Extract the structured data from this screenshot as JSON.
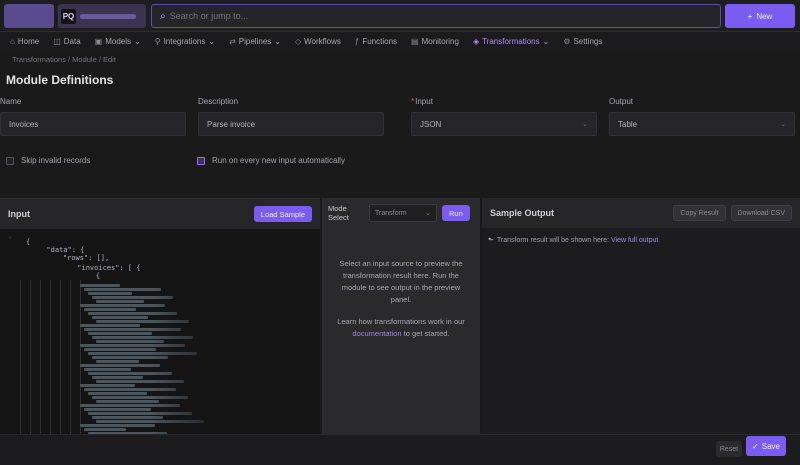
{
  "topbar": {
    "org_badge": "PQ",
    "search_placeholder": "Search or jump to...",
    "search_icon": "search-icon",
    "action_label": "New"
  },
  "nav": {
    "items": [
      {
        "label": "Home",
        "icon": "home-icon",
        "active": false
      },
      {
        "label": "Data",
        "icon": "database-icon",
        "active": false
      },
      {
        "label": "Models",
        "icon": "cube-icon",
        "active": false
      },
      {
        "label": "Integrations",
        "icon": "plug-icon",
        "active": false
      },
      {
        "label": "Pipelines",
        "icon": "flow-icon",
        "active": false
      },
      {
        "label": "Workflows",
        "icon": "workflow-icon",
        "active": false
      },
      {
        "label": "Functions",
        "icon": "function-icon",
        "active": false
      },
      {
        "label": "Monitoring",
        "icon": "chart-icon",
        "active": false
      },
      {
        "label": "Transformations",
        "icon": "transform-icon",
        "active": true
      },
      {
        "label": "Settings",
        "icon": "gear-icon",
        "active": false
      }
    ]
  },
  "breadcrumb": "Transformations / Module / Edit",
  "page_title": "Module Definitions",
  "form": {
    "fields": [
      {
        "label": "Name",
        "value": "Invoices",
        "required": false,
        "select": false
      },
      {
        "label": "Description",
        "value": "Parse invoice",
        "required": false,
        "select": false
      },
      {
        "label": "Input",
        "value": "JSON",
        "required": true,
        "select": true
      },
      {
        "label": "Output",
        "value": "Table",
        "required": false,
        "select": true
      }
    ],
    "checks": [
      {
        "label": "Skip invalid records",
        "checked": false
      },
      {
        "label": "Run on every new input automatically",
        "checked": true
      }
    ]
  },
  "panels": {
    "left": {
      "title": "Input",
      "button": "Load Sample",
      "code_lines": [
        "{",
        "  \"data\": {",
        "    \"rows\": [],",
        "      \"invoices\": [ {",
        "        {"
      ]
    },
    "mid": {
      "label": "Mode Select",
      "select_value": "Transform",
      "button": "Run",
      "body_1": "Select an input source to preview the transformation result here. Run the module to see output in the preview panel.",
      "body_2_prefix": "Learn how transformations work in our",
      "body_2_link": "documentation",
      "body_2_suffix": "to get started."
    },
    "right": {
      "title": "Sample Output",
      "btn_1": "Copy Result",
      "btn_2": "Download CSV",
      "line_prefix": "Transform result will be shown here:",
      "line_link": "View full output"
    }
  },
  "footer": {
    "reset_label": "Reset",
    "save_label": "Save"
  }
}
